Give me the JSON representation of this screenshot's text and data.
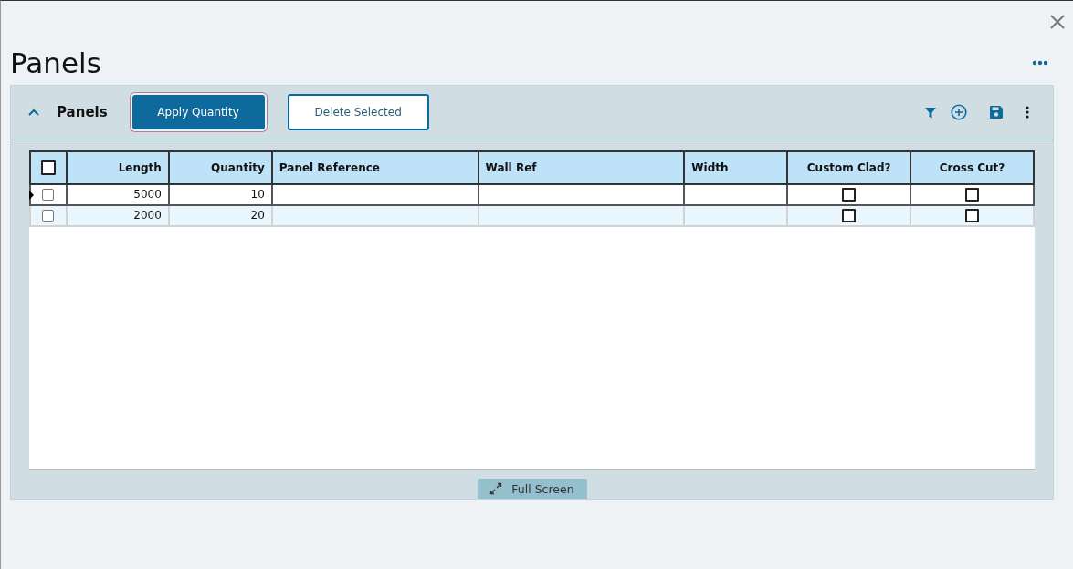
{
  "page": {
    "title": "Panels"
  },
  "section": {
    "title": "Panels",
    "expanded": true,
    "buttons": [
      {
        "label": "Apply Quantity",
        "kind": "primary"
      },
      {
        "label": "Delete Selected",
        "kind": "outline"
      }
    ]
  },
  "table": {
    "select_all_checked": false,
    "columns": [
      {
        "label": "Length",
        "kind": "number"
      },
      {
        "label": "Quantity",
        "kind": "number"
      },
      {
        "label": "Panel Reference",
        "kind": "text"
      },
      {
        "label": "Wall Ref",
        "kind": "text"
      },
      {
        "label": "Width",
        "kind": "text"
      },
      {
        "label": "Custom Clad?",
        "kind": "checkbox"
      },
      {
        "label": "Cross Cut?",
        "kind": "checkbox"
      }
    ],
    "rows": [
      {
        "selected": false,
        "current": true,
        "cells": [
          "5000",
          "10",
          null,
          null,
          null,
          false,
          false
        ]
      },
      {
        "selected": false,
        "current": false,
        "cells": [
          "2000",
          "20",
          null,
          null,
          null,
          false,
          false
        ]
      }
    ]
  },
  "full_screen": {
    "label": "Full Screen"
  }
}
